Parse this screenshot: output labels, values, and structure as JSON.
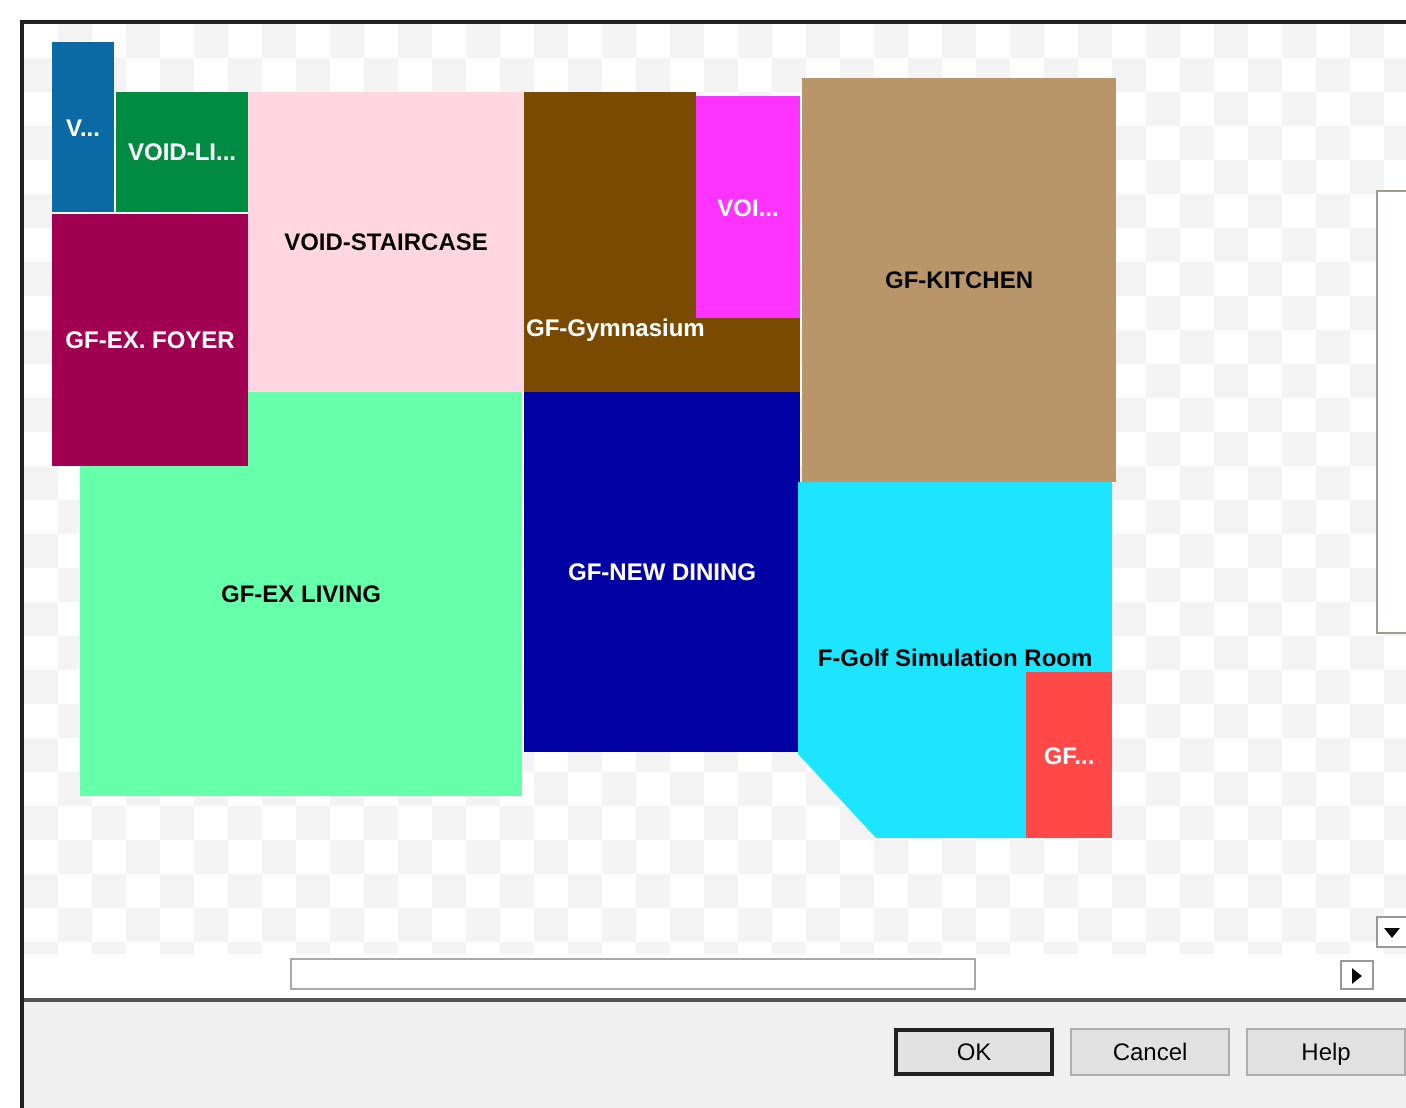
{
  "plan": {
    "rooms": [
      {
        "label": "V...",
        "color": "#0b6aa3",
        "kind": "rect"
      },
      {
        "label": "VOID-LI...",
        "color": "#008a42",
        "kind": "rect"
      },
      {
        "label": "VOID-STAIRCASE",
        "color": "#ffd6e1",
        "kind": "rect"
      },
      {
        "label": "GF-EX LIVING",
        "color": "#66ffaa",
        "kind": "rect"
      },
      {
        "label": "GF-EX. FOYER",
        "color": "#a10052",
        "kind": "rect"
      },
      {
        "label": "GF-Gymnasium",
        "color": "#7a4a00",
        "kind": "notched"
      },
      {
        "label": "VOI...",
        "color": "#ff33ff",
        "kind": "rect"
      },
      {
        "label": "GF-KITCHEN",
        "color": "#b8966a",
        "kind": "rect"
      },
      {
        "label": "GF-NEW DINING",
        "color": "#0000a3",
        "kind": "rect"
      },
      {
        "label": "F-Golf Simulation Room",
        "color": "#1ee5ff",
        "kind": "chamfer"
      },
      {
        "label": "GF...",
        "color": "#ff4949",
        "kind": "rect"
      }
    ]
  },
  "buttons": [
    {
      "label": "OK",
      "default": true
    },
    {
      "label": "Cancel",
      "default": false
    },
    {
      "label": "Help",
      "default": false
    }
  ]
}
